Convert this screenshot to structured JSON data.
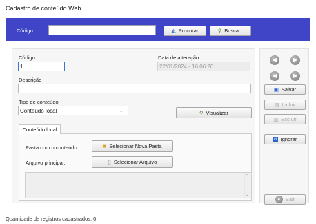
{
  "window": {
    "title": "Cadastro de conteúdo Web"
  },
  "search_bar": {
    "code_label": "Código:",
    "code_value": "",
    "procurar_label": "Procurar",
    "busca_label": "Busca..."
  },
  "form": {
    "codigo_label": "Código",
    "codigo_value": "1",
    "data_label": "Data de alteração",
    "data_value": "22/01/2024 - 16:06:20",
    "descricao_label": "Descrição",
    "descricao_value": "",
    "tipo_label": "Tipo de conteúdo",
    "tipo_value": "Conteúdo local",
    "visualizar_label": "Visualizar"
  },
  "tabs": [
    {
      "label": "Conteúdo local"
    }
  ],
  "tab_content": {
    "pasta_label": "Pasta com o conteúdo:",
    "selecionar_pasta_label": "Selecionar Nova Pasta",
    "arquivo_label": "Arquivo principal:",
    "selecionar_arquivo_label": "Selecionar Arquivo"
  },
  "side": {
    "salvar": "Salvar",
    "incluir": "Incluir",
    "excluir": "Excluir",
    "ignorar": "Ignorar",
    "sair": "Sair"
  },
  "footer": {
    "count_label": "Quantidade de registros cadastrados:",
    "count_value": "0"
  },
  "colors": {
    "accent": "#3f45c6"
  },
  "icons": [
    "binoculars-icon",
    "search-icon",
    "folder-icon",
    "file-icon",
    "save-icon",
    "add-icon",
    "delete-icon",
    "ignore-icon",
    "exit-icon",
    "nav-first-icon",
    "nav-last-icon",
    "nav-prev-icon",
    "nav-next-icon"
  ]
}
